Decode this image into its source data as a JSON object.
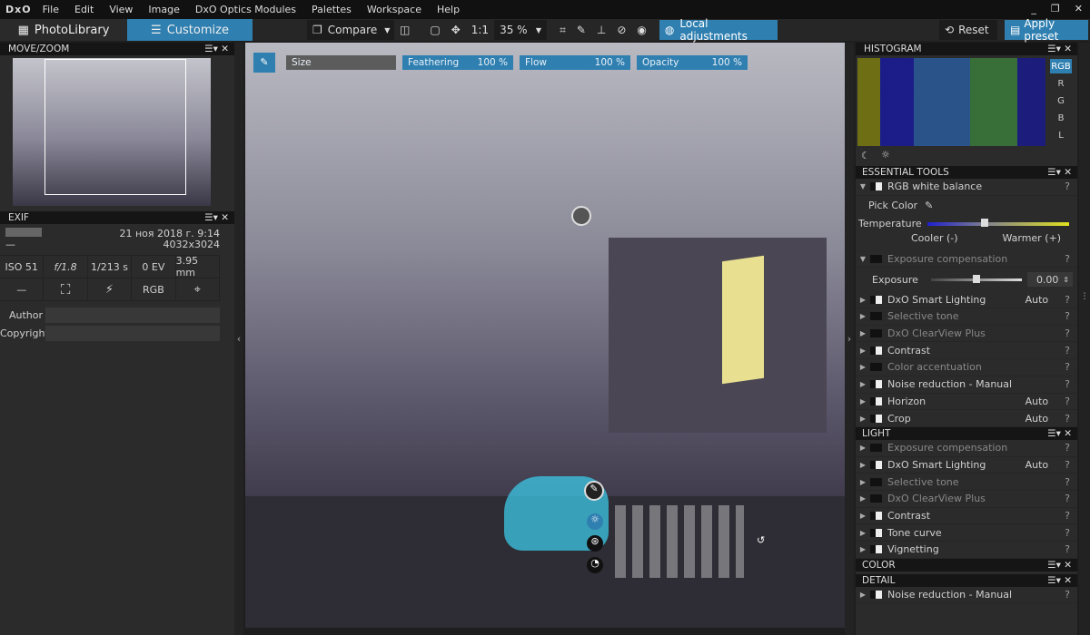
{
  "app": {
    "logo": "DxO",
    "menu": [
      "File",
      "Edit",
      "View",
      "Image",
      "DxO Optics Modules",
      "Palettes",
      "Workspace",
      "Help"
    ],
    "window_controls": [
      "_",
      "❐",
      "✕"
    ]
  },
  "toolbar": {
    "photolibrary": "PhotoLibrary",
    "customize": "Customize",
    "compare": "Compare",
    "one_to_one": "1:1",
    "zoom": "35 %",
    "local_adjustments": "Local adjustments",
    "reset": "Reset",
    "apply_preset": "Apply preset"
  },
  "move_zoom": {
    "title": "MOVE/ZOOM"
  },
  "exif": {
    "title": "EXIF",
    "date": "21 ноя 2018 г. 9:14",
    "dash": "—",
    "resolution": "4032x3024",
    "iso": "ISO 51",
    "aperture": "f/1.8",
    "shutter": "1/213 s",
    "ev": "0 EV",
    "focal": "3.95 mm",
    "row2_dash": "—",
    "color_space": "RGB",
    "author_label": "Author",
    "copyright_label": "Copyright",
    "author_value": "",
    "copyright_value": ""
  },
  "brush": {
    "size_label": "Size",
    "feathering_label": "Feathering",
    "feathering_value": "100 %",
    "flow_label": "Flow",
    "flow_value": "100 %",
    "opacity_label": "Opacity",
    "opacity_value": "100 %"
  },
  "histogram": {
    "title": "HISTOGRAM",
    "channels": [
      "RGB",
      "R",
      "G",
      "B",
      "L"
    ],
    "selected": "RGB"
  },
  "essential": {
    "title": "ESSENTIAL TOOLS",
    "wb_label": "RGB white balance",
    "pick_color": "Pick Color",
    "temperature": "Temperature",
    "cooler": "Cooler (-)",
    "warmer": "Warmer (+)",
    "temperature_position": 0.4,
    "exposure_comp": "Exposure compensation",
    "exposure_label": "Exposure",
    "exposure_value": "0.00",
    "tools": [
      {
        "label": "DxO Smart Lighting",
        "auto": "Auto",
        "on": true,
        "dim": false
      },
      {
        "label": "Selective tone",
        "auto": "",
        "on": false,
        "dim": true
      },
      {
        "label": "DxO ClearView Plus",
        "auto": "",
        "on": false,
        "dim": true
      },
      {
        "label": "Contrast",
        "auto": "",
        "on": true,
        "dim": false
      },
      {
        "label": "Color accentuation",
        "auto": "",
        "on": false,
        "dim": true
      },
      {
        "label": "Noise reduction - Manual",
        "auto": "",
        "on": true,
        "dim": false
      },
      {
        "label": "Horizon",
        "auto": "Auto",
        "on": true,
        "dim": false
      },
      {
        "label": "Crop",
        "auto": "Auto",
        "on": true,
        "dim": false
      }
    ]
  },
  "light": {
    "title": "LIGHT",
    "tools": [
      {
        "label": "Exposure compensation",
        "auto": "",
        "on": false,
        "dim": true
      },
      {
        "label": "DxO Smart Lighting",
        "auto": "Auto",
        "on": true,
        "dim": false
      },
      {
        "label": "Selective tone",
        "auto": "",
        "on": false,
        "dim": true
      },
      {
        "label": "DxO ClearView Plus",
        "auto": "",
        "on": false,
        "dim": true
      },
      {
        "label": "Contrast",
        "auto": "",
        "on": true,
        "dim": false
      },
      {
        "label": "Tone curve",
        "auto": "",
        "on": true,
        "dim": false
      },
      {
        "label": "Vignetting",
        "auto": "",
        "on": true,
        "dim": false
      }
    ]
  },
  "color": {
    "title": "COLOR"
  },
  "detail": {
    "title": "DETAIL",
    "tools": [
      {
        "label": "Noise reduction - Manual",
        "auto": "",
        "on": true,
        "dim": false
      }
    ]
  },
  "help": "?",
  "colors": {
    "accent": "#2f7fb0"
  }
}
